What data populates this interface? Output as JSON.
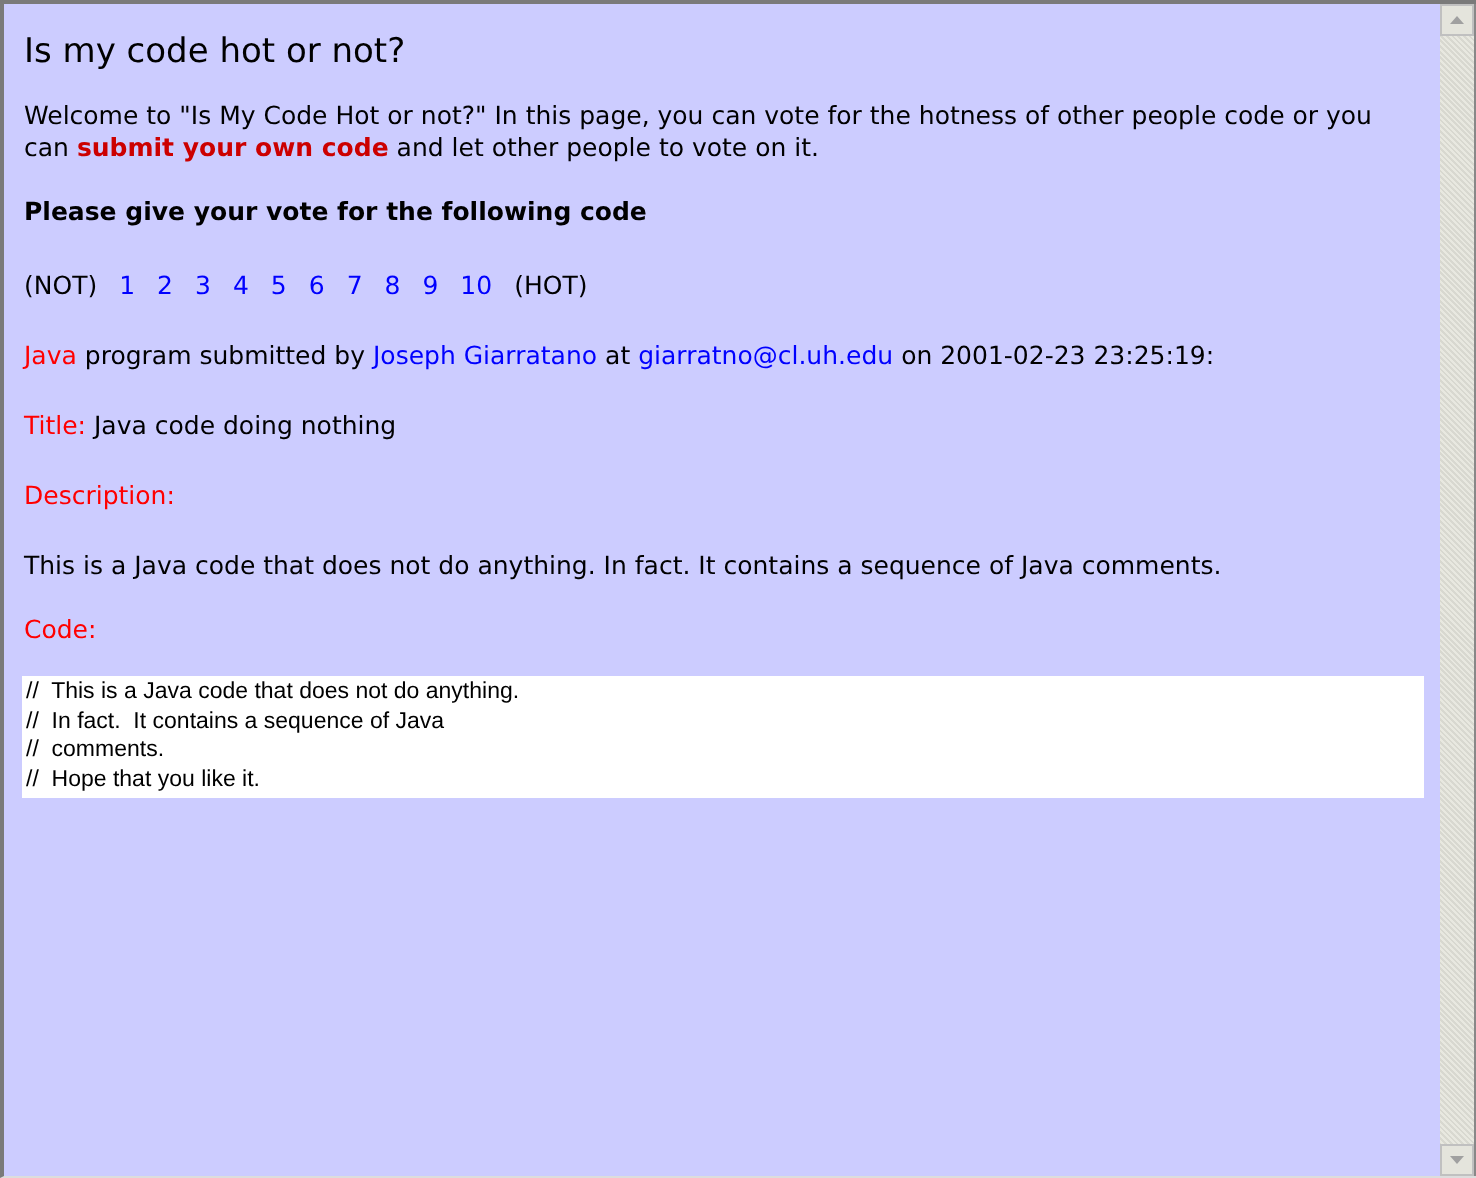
{
  "heading": "Is my code hot or not?",
  "intro": {
    "before": "Welcome to \"Is My Code Hot or not?\" In this page, you can vote for the hotness of other people code or you can ",
    "link": "submit your own code",
    "after": " and let other people to vote on it."
  },
  "vote_prompt": "Please give your vote for the following code",
  "vote": {
    "low_label": "(NOT)",
    "options": [
      "1",
      "2",
      "3",
      "4",
      "5",
      "6",
      "7",
      "8",
      "9",
      "10"
    ],
    "high_label": "(HOT)"
  },
  "submission": {
    "language": "Java",
    "text_1": "program submitted by",
    "author": "Joseph Giarratano",
    "text_2": "at",
    "email": "giarratno@cl.uh.edu",
    "text_3": "on 2001-02-23 23:25:19:"
  },
  "title": {
    "label": "Title:",
    "value": "Java code doing nothing"
  },
  "description": {
    "label": "Description:",
    "value": "This is a Java code that does not do anything. In fact. It contains a sequence of Java comments."
  },
  "code": {
    "label": "Code:",
    "lines": [
      "//  This is a Java code that does not do anything.",
      "//  In fact.  It contains a sequence of Java",
      "//  comments.",
      "//  Hope that you like it."
    ]
  }
}
